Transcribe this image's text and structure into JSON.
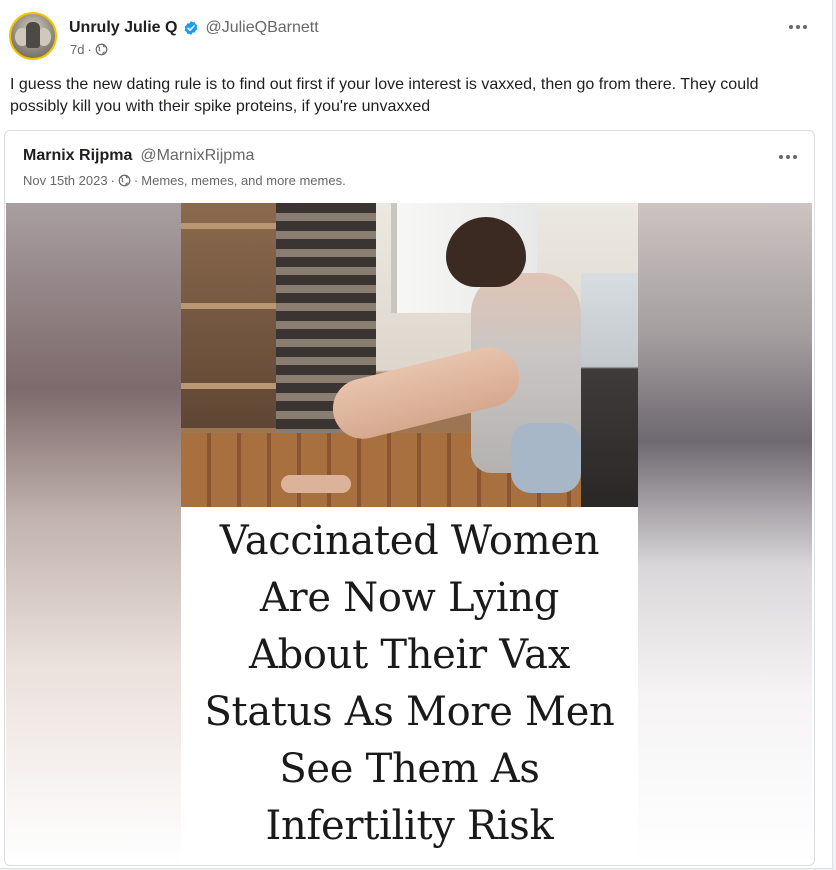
{
  "post": {
    "author_name": "Unruly Julie Q",
    "author_handle": "@JulieQBarnett",
    "time": "7d",
    "text": "I guess the new dating rule is to find out first if your love interest is vaxxed, then go from there. They could possibly kill you with their spike proteins, if you're unvaxxed",
    "icons": {
      "verified": "verified-badge-icon",
      "audience": "globe-icon",
      "more": "more-options-icon"
    },
    "colors": {
      "verified": "#1d9bf0",
      "avatar_ring": "#f2c500"
    }
  },
  "quoted_post": {
    "author_name": "Marnix Rijpma",
    "author_handle": "@MarnixRijpma",
    "date": "Nov 15th 2023",
    "group": "Memes, memes, and more memes.",
    "meme_headline_lines": [
      "Vaccinated Women",
      "Are Now Lying",
      "About Their Vax",
      "Status As More Men",
      "See Them As",
      "Infertility Risk"
    ]
  }
}
